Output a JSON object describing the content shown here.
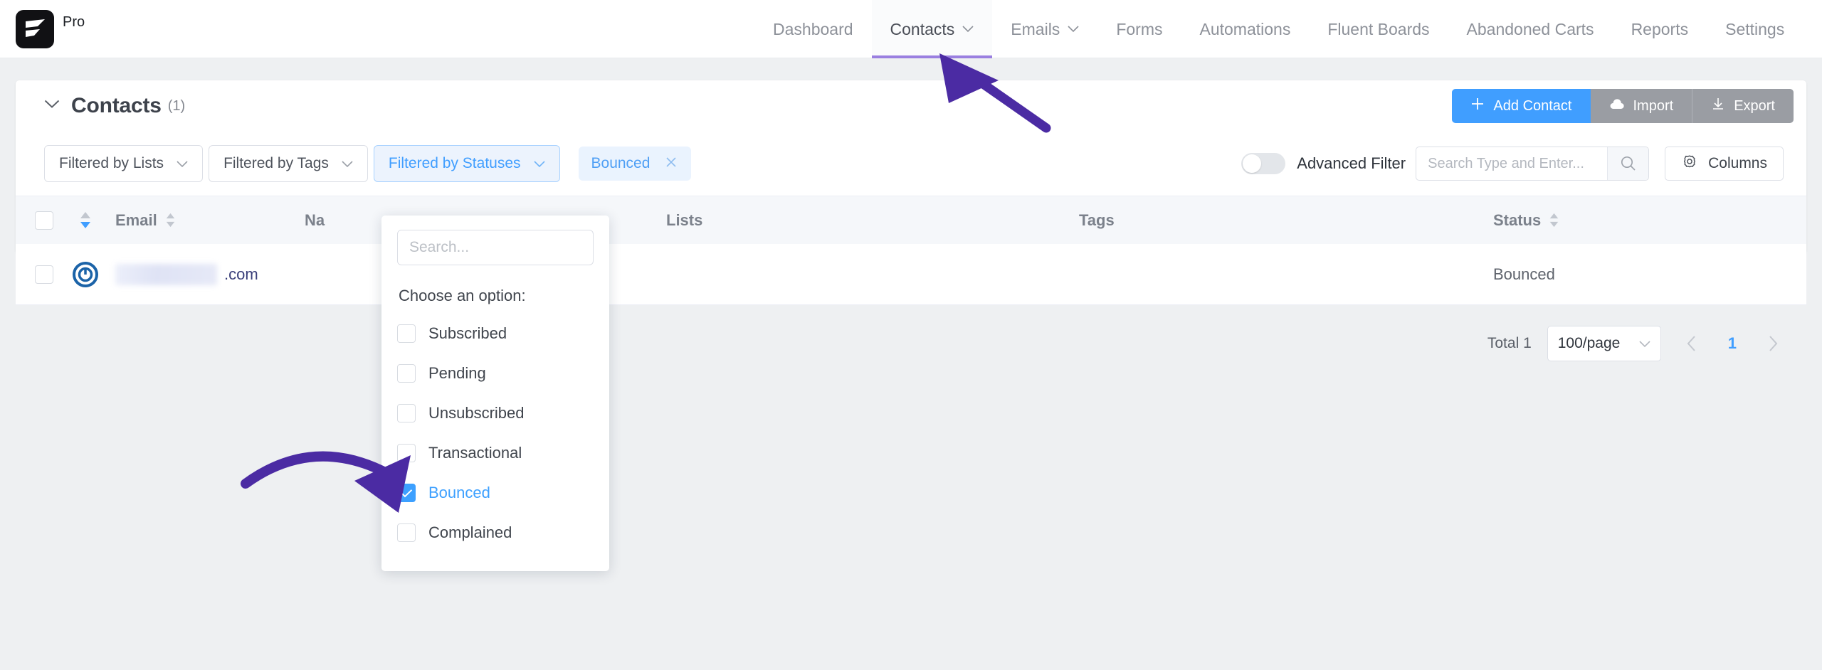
{
  "brand": {
    "pro_label": "Pro",
    "logo_icon": "fluent-crm-logo-icon"
  },
  "nav": {
    "items": [
      {
        "label": "Dashboard",
        "has_caret": false,
        "active": false
      },
      {
        "label": "Contacts",
        "has_caret": true,
        "active": true
      },
      {
        "label": "Emails",
        "has_caret": true,
        "active": false
      },
      {
        "label": "Forms",
        "has_caret": false,
        "active": false
      },
      {
        "label": "Automations",
        "has_caret": false,
        "active": false
      },
      {
        "label": "Fluent Boards",
        "has_caret": false,
        "active": false
      },
      {
        "label": "Abandoned Carts",
        "has_caret": false,
        "active": false
      },
      {
        "label": "Reports",
        "has_caret": false,
        "active": false
      },
      {
        "label": "Settings",
        "has_caret": false,
        "active": false
      }
    ]
  },
  "header": {
    "title": "Contacts",
    "count": "(1)",
    "collapse_icon": "chevron-down-icon",
    "add_contact": "Add Contact",
    "add_icon": "plus-icon",
    "import": "Import",
    "import_icon": "cloud-upload-icon",
    "export": "Export",
    "export_icon": "download-icon"
  },
  "filters": {
    "lists": "Filtered by Lists",
    "tags": "Filtered by Tags",
    "statuses": "Filtered by Statuses",
    "selected_tag": "Bounced",
    "remove_icon": "close-icon",
    "caret_icon": "chevron-down-icon",
    "advanced_filter_label": "Advanced Filter",
    "advanced_filter_on": false,
    "search_placeholder": "Search Type and Enter...",
    "search_value": "",
    "search_icon": "search-icon",
    "columns_label": "Columns",
    "columns_icon": "gear-icon"
  },
  "dropdown": {
    "search_placeholder": "Search...",
    "search_value": "",
    "prompt": "Choose an option:",
    "options": [
      {
        "label": "Subscribed",
        "checked": false
      },
      {
        "label": "Pending",
        "checked": false
      },
      {
        "label": "Unsubscribed",
        "checked": false
      },
      {
        "label": "Transactional",
        "checked": false
      },
      {
        "label": "Bounced",
        "checked": true
      },
      {
        "label": "Complained",
        "checked": false
      }
    ]
  },
  "table": {
    "columns": [
      {
        "key": "email",
        "label": "Email",
        "sortable": true
      },
      {
        "key": "name",
        "label": "Na",
        "sortable": false
      },
      {
        "key": "lists",
        "label": "Lists",
        "sortable": false
      },
      {
        "key": "tags",
        "label": "Tags",
        "sortable": false
      },
      {
        "key": "status",
        "label": "Status",
        "sortable": true
      }
    ],
    "sort_icon": "sort-arrows-icon",
    "rows": [
      {
        "avatar_icon": "contact-avatar-icon",
        "email_masked": true,
        "email_suffix": ".com",
        "name": "",
        "lists": "",
        "tags": "",
        "status": "Bounced"
      }
    ]
  },
  "pagination": {
    "total": "Total 1",
    "page_size": "100/page",
    "page_size_caret": "chevron-down-icon",
    "prev_icon": "chevron-left-icon",
    "next_icon": "chevron-right-icon",
    "current_page": "1"
  },
  "colors": {
    "accent_blue": "#409eff",
    "annotation_purple": "#4b2ba3",
    "nav_underline": "#9a7fe0",
    "header_grey": "#9a9da3"
  }
}
